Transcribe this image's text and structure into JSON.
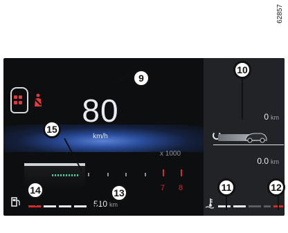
{
  "figure_ref": "62857",
  "speedometer": {
    "value": "80",
    "unit": "km/h"
  },
  "tachometer": {
    "multiplier": "x 1000",
    "redline_labels": [
      "7",
      "8"
    ]
  },
  "fuel": {
    "range_value": "510",
    "range_unit": "km",
    "level": 0.55
  },
  "trip": {
    "top_value": "0",
    "top_unit": "km",
    "bottom_value": "0.0",
    "bottom_unit": "km"
  },
  "coolant": {
    "level": 0.6
  },
  "callouts": {
    "c9": "9",
    "c10": "10",
    "c11": "11",
    "c12": "12",
    "c13": "13",
    "c14": "14",
    "c15": "15"
  },
  "colors": {
    "warning_red": "#d82b2b",
    "eco_green": "#2fd1a0",
    "glow_blue": "#5b82d6"
  }
}
